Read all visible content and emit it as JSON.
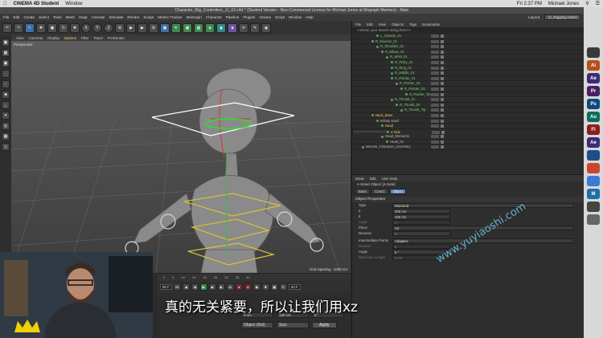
{
  "macbar": {
    "app": "CINEMA 4D Student",
    "menu": "Window",
    "time": "Fri 2:37 PM",
    "user": "Michael Jones"
  },
  "title": "Character_Rig_Controllers_JJ_03.c4d * (Student Version - Non-Commercial License for Michael Jones at Mograph Mentors) - Main",
  "menubar": {
    "items": [
      "File",
      "Edit",
      "Create",
      "Select",
      "Tools",
      "Mesh",
      "Snap",
      "Animate",
      "Simulate",
      "Render",
      "Sculpt",
      "Motion Tracker",
      "MoGraph",
      "Character",
      "Pipeline",
      "Plugins",
      "Octane",
      "Script",
      "Window",
      "Help"
    ],
    "layout_label": "Layout:",
    "layout_value": "JJ_Rigging (User)"
  },
  "toolbar": {
    "axis_labels": [
      "X",
      "Y",
      "Z"
    ]
  },
  "viewport": {
    "menu": [
      "View",
      "Cameras",
      "Display",
      "Options",
      "Filter",
      "Panel",
      "ProRender"
    ],
    "active_menu": "Options",
    "camera_label": "Perspective",
    "grid_spacing": "Grid Spacing : 1000 cm"
  },
  "timeline": {
    "ticks": [
      "0",
      "5",
      "10",
      "15",
      "20",
      "25",
      "30",
      "35",
      "40"
    ],
    "current_frame": "90 F",
    "end_frame": "40 F"
  },
  "coords": {
    "row1": [
      "0 cm",
      "100 cm",
      "0 °"
    ],
    "coord_mode": "Object (Rel)",
    "size_mode": "Size",
    "apply": "Apply"
  },
  "objects": {
    "menu": [
      "File",
      "Edit",
      "View",
      "Objects",
      "Tags",
      "Bookmarks"
    ],
    "search_placeholder": "<<Enter your search string here>>",
    "tree": [
      {
        "label": "L_Clavicle_01",
        "indent": 30,
        "style": "green"
      },
      {
        "label": "R_Clavicle_01",
        "indent": 24,
        "style": "green"
      },
      {
        "label": "R_Shoulder_01",
        "indent": 30,
        "style": "green"
      },
      {
        "label": "R_Elbow_01",
        "indent": 36,
        "style": "green"
      },
      {
        "label": "R_Wrist_01",
        "indent": 42,
        "style": "green"
      },
      {
        "label": "R_Pinky_01",
        "indent": 48,
        "style": "green"
      },
      {
        "label": "R_Ring_01",
        "indent": 48,
        "style": "green"
      },
      {
        "label": "R_Middle_01",
        "indent": 48,
        "style": "green"
      },
      {
        "label": "R_Pointer_01",
        "indent": 48,
        "style": "green"
      },
      {
        "label": "R_Pointer_02",
        "indent": 54,
        "style": "green"
      },
      {
        "label": "R_Pointer_03",
        "indent": 60,
        "style": "green"
      },
      {
        "label": "R_Pointer_Tip",
        "indent": 66,
        "style": "green"
      },
      {
        "label": "R_Thumb_01",
        "indent": 48,
        "style": "green"
      },
      {
        "label": "R_Thumb_02",
        "indent": 54,
        "style": "green"
      },
      {
        "label": "R_Thumb_Tip",
        "indent": 60,
        "style": "green"
      },
      {
        "label": "Neck_Base",
        "indent": 24,
        "style": "yellow"
      },
      {
        "label": "Infinity Scarf",
        "indent": 30,
        "style": "normal"
      },
      {
        "label": "Head",
        "indent": 36,
        "style": "yellow"
      },
      {
        "label": "4-Side",
        "indent": 42,
        "style": "yellow",
        "selected": true
      },
      {
        "label": "Head_Elements",
        "indent": 36,
        "style": "normal"
      },
      {
        "label": "Head_02",
        "indent": 42,
        "style": "normal"
      },
      {
        "label": "Women_Character_Geometry",
        "indent": 12,
        "style": "normal"
      }
    ]
  },
  "attributes": {
    "menu": [
      "Mode",
      "Edit",
      "User Data"
    ],
    "title": "4-Sided Object [4-Side]",
    "tabs": [
      "Basic",
      "Coord.",
      "Object"
    ],
    "active_tab": "Object",
    "section1": "Object Properties",
    "props": [
      {
        "label": "Type",
        "value": "Diamond",
        "wide": true
      },
      {
        "label": "a",
        "value": "200 cm"
      },
      {
        "label": "b",
        "value": "100 cm"
      },
      {
        "label": "Angle",
        "value": "0 °",
        "dim": true
      },
      {
        "label": "Plane",
        "value": "XZ",
        "wide": true
      },
      {
        "label": "Reverse",
        "value": "□"
      }
    ],
    "section2_label": "Intermediate Points",
    "section2_value": "Adaptive",
    "props2": [
      {
        "label": "Number",
        "value": "8",
        "dim": true
      },
      {
        "label": "Angle",
        "value": "5 °"
      },
      {
        "label": "Maximum Length",
        "value": "5 cm",
        "dim": true
      }
    ]
  },
  "dock": {
    "apps": [
      {
        "name": "app-icon",
        "label": "",
        "color": "#3a3a3a"
      },
      {
        "name": "illustrator-icon",
        "label": "Ai",
        "color": "#b5501a"
      },
      {
        "name": "after-effects-icon",
        "label": "Ae",
        "color": "#3b2c78"
      },
      {
        "name": "premiere-icon",
        "label": "Pr",
        "color": "#4b1e66"
      },
      {
        "name": "photoshop-icon",
        "label": "Ps",
        "color": "#0d4a7a"
      },
      {
        "name": "audition-icon",
        "label": "Au",
        "color": "#0f6b5b"
      },
      {
        "name": "flash-icon",
        "label": "Fl",
        "color": "#8b1e1e"
      },
      {
        "name": "after-effects-icon-2",
        "label": "Ae",
        "color": "#3b2c78"
      },
      {
        "name": "cinema4d-icon",
        "label": "",
        "color": "#1f4d8a"
      },
      {
        "name": "chrome-icon",
        "label": "",
        "color": "#c8472f"
      },
      {
        "name": "finder-icon",
        "label": "",
        "color": "#3d7ad6"
      },
      {
        "name": "media-icon",
        "label": "M",
        "color": "#1d6fa8"
      },
      {
        "name": "app-icon-2",
        "label": "",
        "color": "#444"
      },
      {
        "name": "app-icon-3",
        "label": "",
        "color": "#666"
      }
    ]
  },
  "overlay": {
    "subtitle": "真的无关紧要，所以让我们用xz",
    "watermark": "www.yuyiaoshi.com"
  }
}
